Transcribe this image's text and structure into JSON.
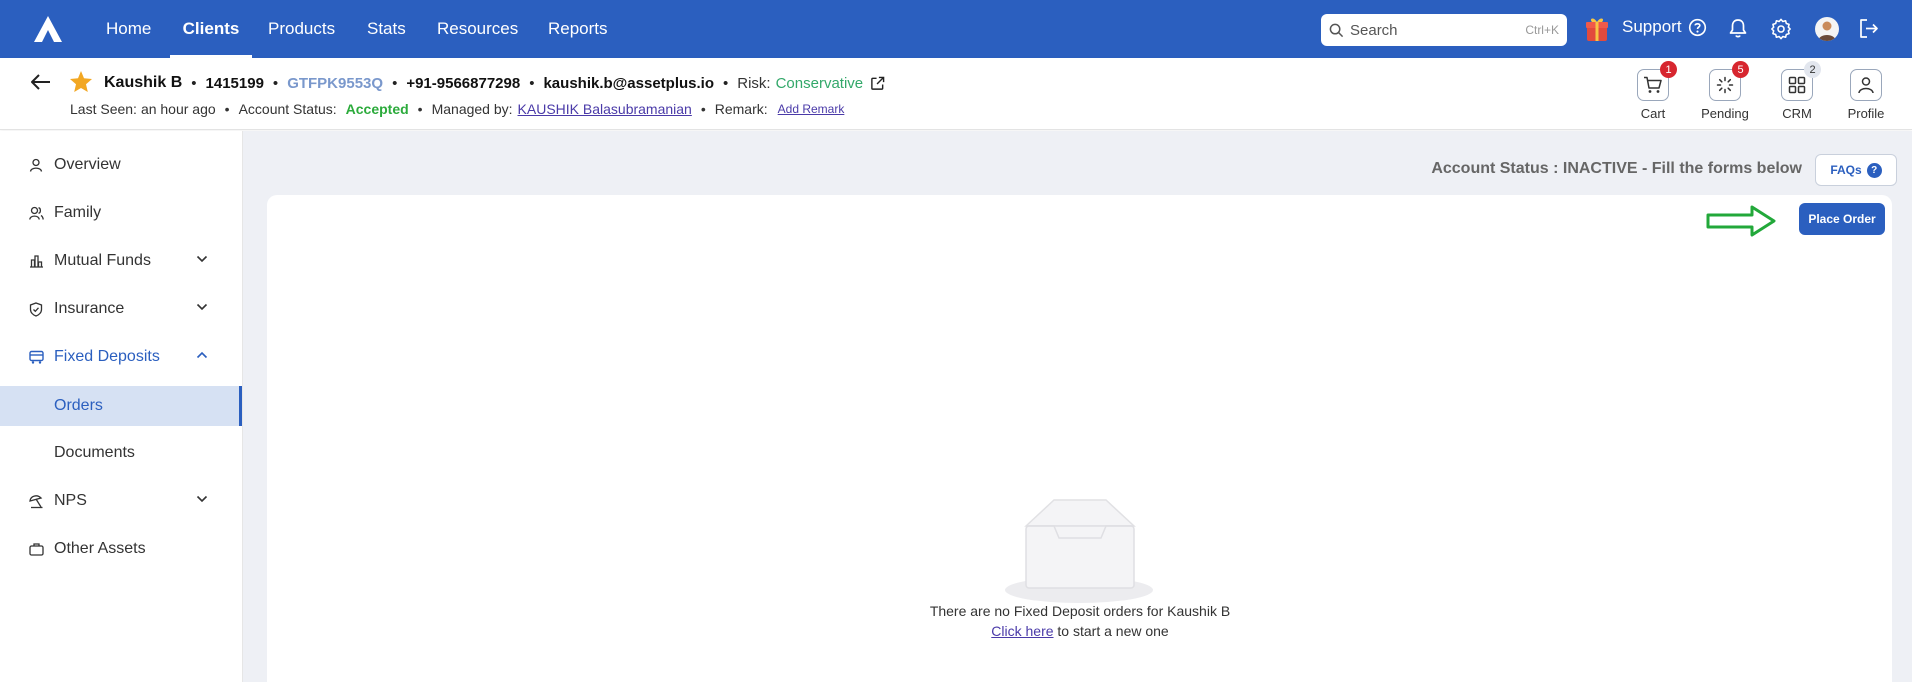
{
  "nav": {
    "items": [
      {
        "label": "Home",
        "active": false
      },
      {
        "label": "Clients",
        "active": true
      },
      {
        "label": "Products",
        "active": false
      },
      {
        "label": "Stats",
        "active": false
      },
      {
        "label": "Resources",
        "active": false
      },
      {
        "label": "Reports",
        "active": false
      }
    ],
    "search_placeholder": "Search",
    "search_shortcut": "Ctrl+K",
    "support_label": "Support",
    "brand_color": "#2b5fbf"
  },
  "client": {
    "name": "Kaushik B",
    "id": "1415199",
    "pan": "GTFPK9553Q",
    "phone": "+91-9566877298",
    "email": "kaushik.b@assetplus.io",
    "risk_label": "Risk:",
    "risk_value": "Conservative",
    "last_seen_label": "Last Seen:",
    "last_seen_value": "an hour ago",
    "account_status_label": "Account Status:",
    "account_status_value": "Accepted",
    "managed_by_label": "Managed by:",
    "managed_by_value": "KAUSHIK Balasubramanian",
    "remark_label": "Remark:",
    "add_remark": "Add Remark"
  },
  "header_actions": [
    {
      "label": "Cart",
      "badge": "1"
    },
    {
      "label": "Pending",
      "badge": "5"
    },
    {
      "label": "CRM",
      "badge": "2"
    },
    {
      "label": "Profile",
      "badge": ""
    }
  ],
  "sidebar": {
    "items": [
      {
        "label": "Overview"
      },
      {
        "label": "Family"
      },
      {
        "label": "Mutual Funds"
      },
      {
        "label": "Insurance"
      },
      {
        "label": "Fixed Deposits"
      },
      {
        "label": "Orders"
      },
      {
        "label": "Documents"
      },
      {
        "label": "NPS"
      },
      {
        "label": "Other Assets"
      }
    ]
  },
  "main": {
    "account_status_text": "Account Status :  INACTIVE - Fill the forms below",
    "faqs_label": "FAQs",
    "place_order_label": "Place Order",
    "empty_message": "There are no Fixed Deposit orders for Kaushik B",
    "click_here": "Click here",
    "start_new": " to start a new one"
  }
}
